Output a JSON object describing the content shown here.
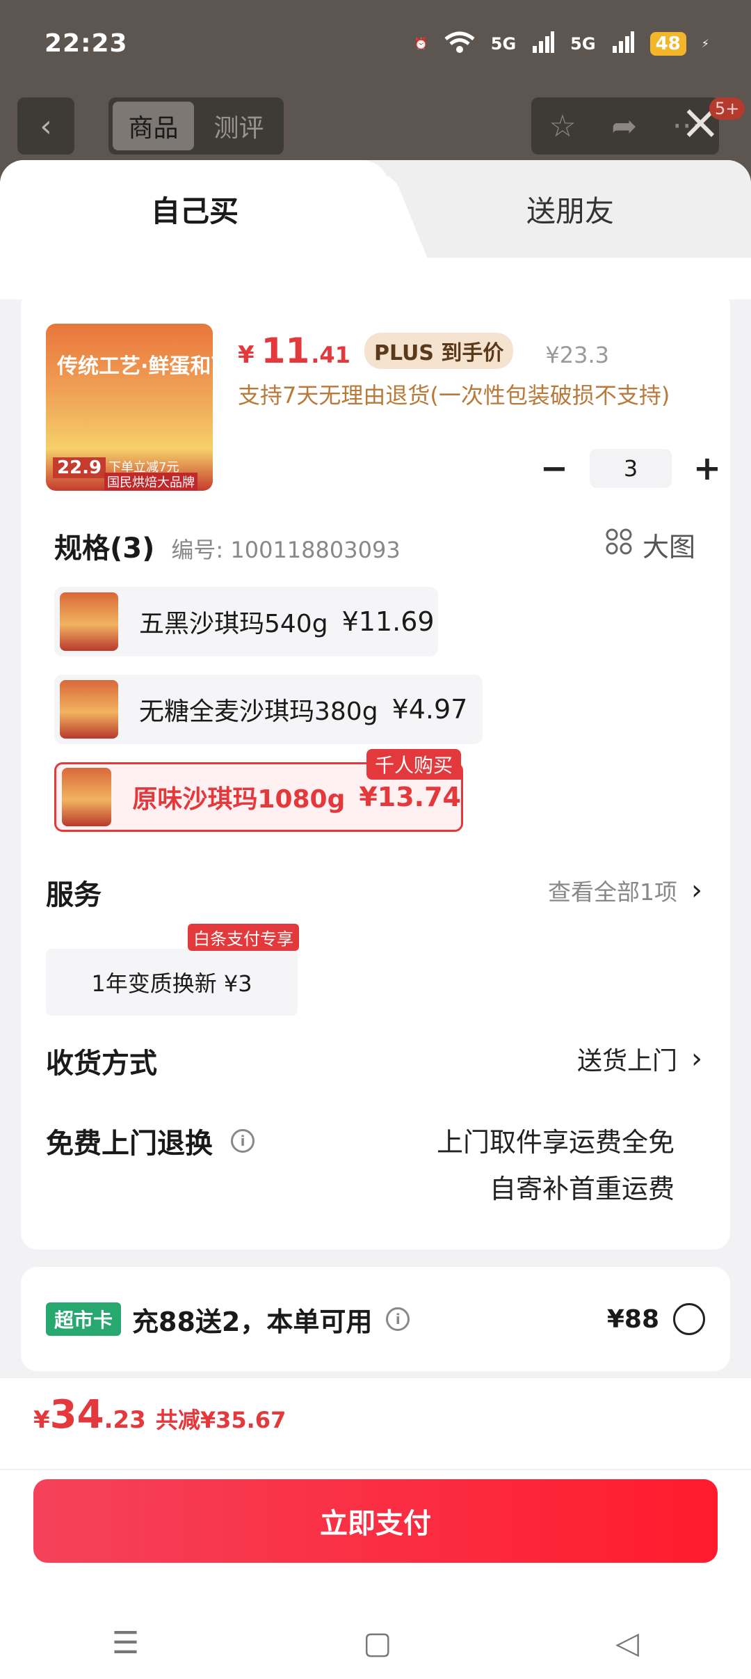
{
  "status_bar": {
    "time": "22:23",
    "signal1": "5G",
    "signal2": "5G",
    "battery": "48"
  },
  "topnav": {
    "tab_product": "商品",
    "tab_review": "测评",
    "badge": "5+"
  },
  "sheet": {
    "tab_self": "自己买",
    "tab_friend": "送朋友"
  },
  "product": {
    "thumb_title": "传统工艺·鲜蛋和面",
    "thumb_price": "22.9",
    "thumb_promo": "下单立减7元",
    "thumb_brand": "国民烘焙大品牌",
    "currency": "¥",
    "price_int": "11",
    "price_dec": ".41",
    "plus_tag": "PLUS 到手价",
    "orig_price": "¥23.3",
    "return_note": "支持7天无理由退货(一次性包装破损不支持)",
    "qty": "3",
    "qty_minus": "−",
    "qty_plus": "+"
  },
  "spec": {
    "title": "规格(3)",
    "code": "编号: 100118803093",
    "big_pic": "大图",
    "options": [
      {
        "label": "五黑沙琪玛540g",
        "price": "¥11.69"
      },
      {
        "label": "无糖全麦沙琪玛380g",
        "price": "¥4.97"
      },
      {
        "label": "原味沙琪玛1080g",
        "price": "¥13.74",
        "badge": "千人购买"
      }
    ]
  },
  "service": {
    "title": "服务",
    "view_all": "查看全部1项",
    "item": "1年变质换新  ¥3",
    "item_badge": "白条支付专享"
  },
  "delivery": {
    "title": "收货方式",
    "value": "送货上门"
  },
  "free_return": {
    "title": "免费上门退换",
    "line1": "上门取件享运费全免",
    "line2": "自寄补首重运费"
  },
  "card": {
    "tag": "超市卡",
    "text": "充88送2，本单可用",
    "price": "¥88"
  },
  "footer": {
    "currency": "¥",
    "total_int": "34",
    "total_dec": ".23",
    "discount": "共减¥35.67",
    "pay": "立即支付"
  },
  "navbar": {
    "menu": "☰",
    "home": "▢",
    "back": "◁"
  }
}
